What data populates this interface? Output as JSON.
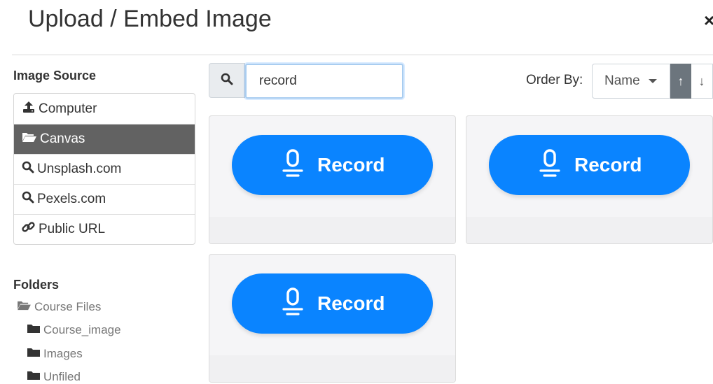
{
  "dialog": {
    "title": "Upload / Embed Image",
    "close_label": "×"
  },
  "sidebar": {
    "image_source_title": "Image Source",
    "sources": [
      {
        "label": "Computer",
        "icon": "upload-icon"
      },
      {
        "label": "Canvas",
        "icon": "folder-open-icon",
        "active": true
      },
      {
        "label": "Unsplash.com",
        "icon": "search-icon"
      },
      {
        "label": "Pexels.com",
        "icon": "search-icon"
      },
      {
        "label": "Public URL",
        "icon": "link-icon"
      }
    ],
    "folders_title": "Folders",
    "folders": [
      {
        "label": "Course Files",
        "icon": "folder-open-icon"
      },
      {
        "label": "Course_image",
        "icon": "folder-icon"
      },
      {
        "label": "Images",
        "icon": "folder-icon"
      },
      {
        "label": "Unfiled",
        "icon": "folder-icon"
      }
    ]
  },
  "search": {
    "value": "record",
    "icon": "search-icon"
  },
  "order": {
    "label": "Order By:",
    "selected": "Name",
    "asc_label": "↑",
    "desc_label": "↓"
  },
  "results": [
    {
      "label": "Record"
    },
    {
      "label": "Record"
    },
    {
      "label": "Record"
    }
  ],
  "colors": {
    "accent": "#0a84ff",
    "active_source_bg": "#626262"
  }
}
